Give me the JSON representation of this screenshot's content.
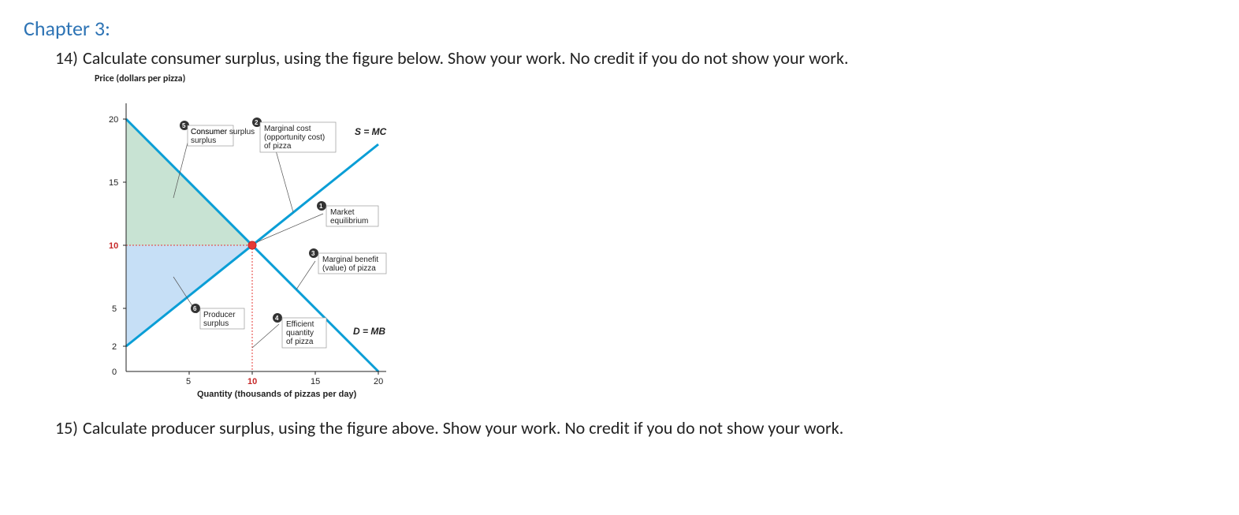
{
  "chapter": "Chapter 3:",
  "q14": {
    "num": "14)",
    "text": "Calculate consumer surplus, using the figure below.  Show your work.  No credit if you do not show your work."
  },
  "q15": {
    "num": "15)",
    "text": "Calculate producer surplus, using the figure above.  Show your work.  No credit if you do not show your work."
  },
  "figure": {
    "y_title": "Price (dollars per pizza)",
    "x_title": "Quantity (thousands of pizzas per day)",
    "y_ticks": {
      "t20": "20",
      "t15": "15",
      "t10": "10",
      "t5": "5",
      "t2": "2",
      "t0": "0"
    },
    "x_ticks": {
      "t5": "5",
      "t10": "10",
      "t15": "15",
      "t20": "20"
    },
    "supply_label": "S = MC",
    "demand_label": "D = MB",
    "callouts": {
      "cs": "Consumer surplus",
      "ps": "Producer surplus",
      "mc1": "Marginal cost",
      "mc2": "(opportunity cost)",
      "mc3": "of pizza",
      "me1": "Market",
      "me2": "equilibrium",
      "mb1": "Marginal benefit",
      "mb2": "(value) of pizza",
      "eq1": "Efficient",
      "eq2": "quantity",
      "eq3": "of pizza"
    },
    "badges": {
      "b1": "1",
      "b2": "2",
      "b3": "3",
      "b4": "4",
      "b5": "5",
      "b6": "6"
    }
  },
  "chart_data": {
    "type": "line",
    "title": "Consumer and Producer Surplus at Market Equilibrium",
    "xlabel": "Quantity (thousands of pizzas per day)",
    "ylabel": "Price (dollars per pizza)",
    "xlim": [
      0,
      20
    ],
    "ylim": [
      0,
      20
    ],
    "series": [
      {
        "name": "S = MC (Supply / Marginal cost)",
        "points": [
          [
            0,
            2
          ],
          [
            20,
            18
          ]
        ]
      },
      {
        "name": "D = MB (Demand / Marginal benefit)",
        "points": [
          [
            0,
            20
          ],
          [
            20,
            0
          ]
        ]
      }
    ],
    "equilibrium": {
      "quantity": 10,
      "price": 10
    },
    "annotations": [
      "Consumer surplus: triangle (0,10)-(0,20)-(10,10)",
      "Producer surplus: triangle (0,2)-(0,10)-(10,10)"
    ]
  }
}
